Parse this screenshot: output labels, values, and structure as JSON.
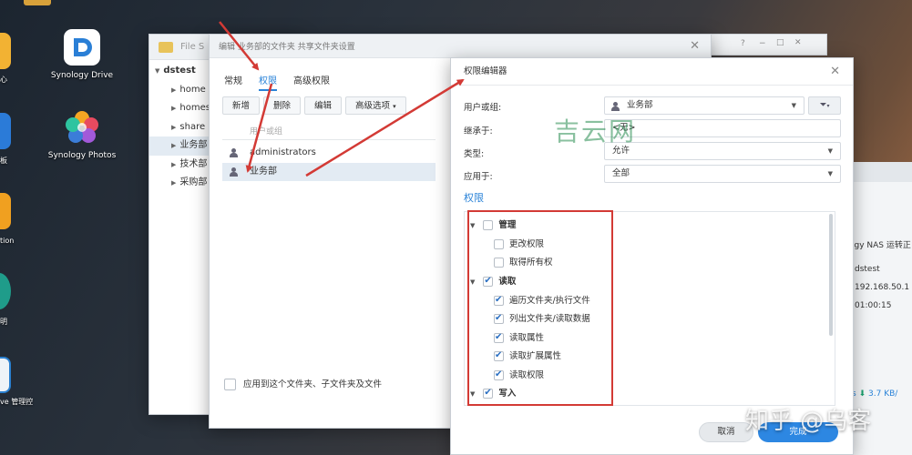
{
  "desktop": {
    "icons": [
      {
        "label": "Synology Drive"
      },
      {
        "label": "Synology Photos"
      }
    ],
    "edge_labels": [
      "心",
      "板",
      "tion",
      "明",
      "ve 管理控"
    ]
  },
  "file_station": {
    "title": "File S",
    "tree_root": "dstest",
    "tree_items": [
      "home",
      "homes",
      "share",
      "业务部",
      "技术部",
      "采购部"
    ]
  },
  "perm_dialog": {
    "title": "编辑 业务部的文件夹 共享文件夹设置",
    "tabs": [
      "常规",
      "权限",
      "高级权限"
    ],
    "toolbar": {
      "add": "新增",
      "delete": "删除",
      "edit": "编辑",
      "advanced": "高级选项"
    },
    "list_header": "用户或组",
    "users": [
      {
        "name": "administrators"
      },
      {
        "name": "业务部"
      }
    ],
    "apply_label": "应用到这个文件夹、子文件夹及文件"
  },
  "perm_editor": {
    "title": "权限编辑器",
    "fields": {
      "user_label": "用户或组:",
      "user_value": "业务部",
      "inherit_label": "继承于:",
      "inherit_value": "<无>",
      "type_label": "类型:",
      "type_value": "允许",
      "apply_label": "应用于:",
      "apply_value": "全部"
    },
    "permissions_heading": "权限",
    "permissions": [
      {
        "label": "管理",
        "checked": false,
        "group": true
      },
      {
        "label": "更改权限",
        "checked": false,
        "group": false
      },
      {
        "label": "取得所有权",
        "checked": false,
        "group": false
      },
      {
        "label": "读取",
        "checked": true,
        "group": true
      },
      {
        "label": "遍历文件夹/执行文件",
        "checked": true,
        "group": false
      },
      {
        "label": "列出文件夹/读取数据",
        "checked": true,
        "group": false
      },
      {
        "label": "读取属性",
        "checked": true,
        "group": false
      },
      {
        "label": "读取扩展属性",
        "checked": true,
        "group": false
      },
      {
        "label": "读取权限",
        "checked": true,
        "group": false
      },
      {
        "label": "写入",
        "checked": true,
        "group": true
      }
    ],
    "cancel_label": "取消",
    "done_label": "完成"
  },
  "right_panel": {
    "lines": [
      "ogy NAS 运转正",
      "dstest",
      "192.168.50.1",
      "01:00:15"
    ],
    "net_speed": "3.7 KB/"
  },
  "watermarks": {
    "center": "吉云网",
    "bottom": "知乎 @乌客"
  },
  "colors": {
    "accent": "#2a83d8",
    "annotation_red": "#d33a35"
  }
}
